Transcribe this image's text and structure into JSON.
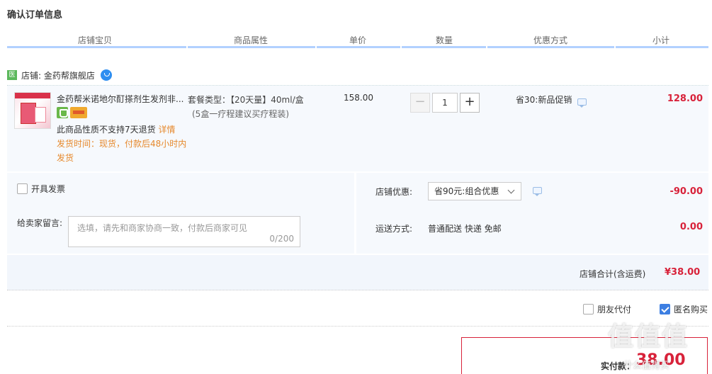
{
  "page_title": "确认订单信息",
  "table_headers": [
    "店铺宝贝",
    "商品属性",
    "单价",
    "数量",
    "优惠方式",
    "小计"
  ],
  "shop": {
    "icon_text": "医",
    "label": "店铺: 金药帮旗舰店"
  },
  "item": {
    "name": "金药帮米诺地尔酊搽剂生发剂非...",
    "return_note": "此商品性质不支持7天退货",
    "return_link": "详情",
    "ship_time": "发货时间：现货，付款后48小时内发货",
    "attr_line1": "套餐类型：【20天量】40ml/盒",
    "attr_line2": "(5盒一疗程建议买疗程装)",
    "unit_price": "158.00",
    "quantity": "1",
    "minus_label": "−",
    "plus_label": "+",
    "promo": "省30:新品促销",
    "subtotal": "128.00"
  },
  "options": {
    "invoice_label": "开具发票",
    "message_label": "给卖家留言:",
    "message_placeholder": "选填，请先和商家协商一致，付款后商家可见",
    "message_count": "0/200",
    "shop_discount_label": "店铺优惠:",
    "shop_discount_select": "省90元:组合优惠",
    "shop_discount_value": "-90.00",
    "shipping_label": "运送方式:",
    "shipping_method": "普通配送 快递 免邮",
    "shipping_value": "0.00"
  },
  "total": {
    "label": "店铺合计(含运费)",
    "value": "¥38.00"
  },
  "checkout": {
    "friend_pay_label": "朋友代付",
    "anonymous_label": "匿名购买",
    "anonymous_checked": true,
    "pay_label": "实付款：",
    "pay_value": "38.00"
  },
  "watermark": {
    "text": "值值值",
    "sub": "什么值得买"
  },
  "colors": {
    "accent_red": "#d8223a",
    "header_line": "#b2d1ff",
    "panel_bg": "#f6f9fd",
    "orange": "#e6892d",
    "checkbox_blue": "#3d7fe2"
  }
}
